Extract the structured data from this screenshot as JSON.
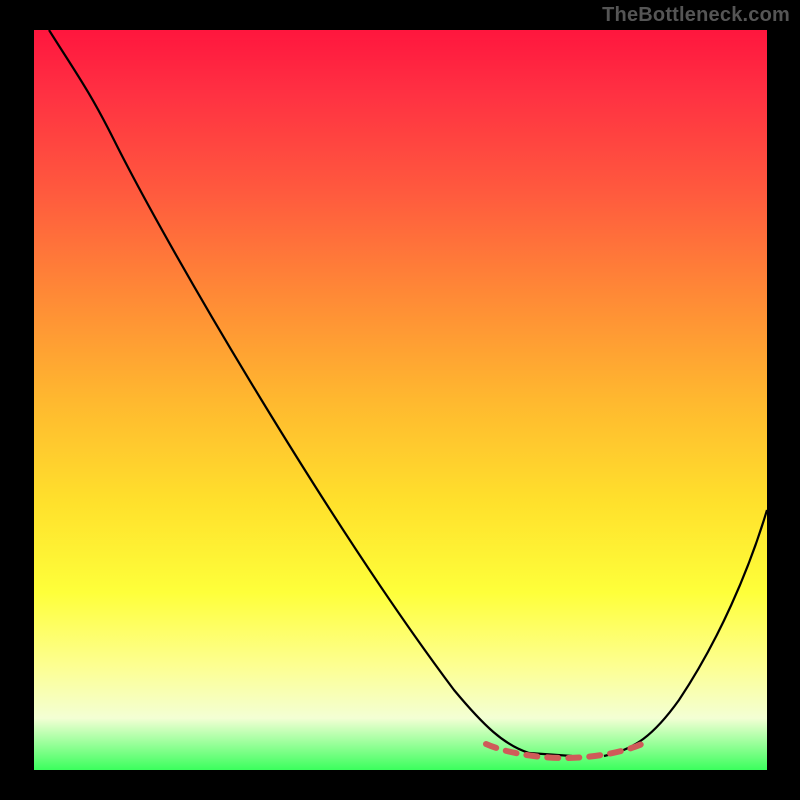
{
  "watermark": "TheBottleneck.com",
  "colors": {
    "gradient_top": "#ff163e",
    "gradient_mid1": "#ff8a36",
    "gradient_mid2": "#ffe12c",
    "gradient_bottom": "#3bff5d",
    "curve": "#000000",
    "trough_marker": "#cf5b59",
    "frame": "#000000"
  },
  "chart_data": {
    "type": "line",
    "title": "",
    "xlabel": "",
    "ylabel": "",
    "xlim": [
      0,
      100
    ],
    "ylim": [
      0,
      100
    ],
    "notes": "Bottleneck curve. y-axis encodes bottleneck severity (100 at top = worst/red, 0 at bottom = no bottleneck/green). Minimum (optimal match) is around x≈72–78. Red dashed segment marks the flat trough region.",
    "series": [
      {
        "name": "bottleneck-severity",
        "x": [
          2,
          6,
          10,
          14,
          18,
          24,
          30,
          36,
          42,
          48,
          54,
          60,
          64,
          68,
          72,
          76,
          80,
          84,
          88,
          92,
          96,
          100
        ],
        "y": [
          100,
          96,
          92,
          87,
          81,
          72,
          62,
          52,
          42,
          33,
          24,
          16,
          10,
          5,
          2,
          1,
          2,
          6,
          13,
          22,
          32,
          42
        ]
      }
    ],
    "trough_marker": {
      "x_start": 63,
      "x_end": 83,
      "y": 2
    }
  }
}
